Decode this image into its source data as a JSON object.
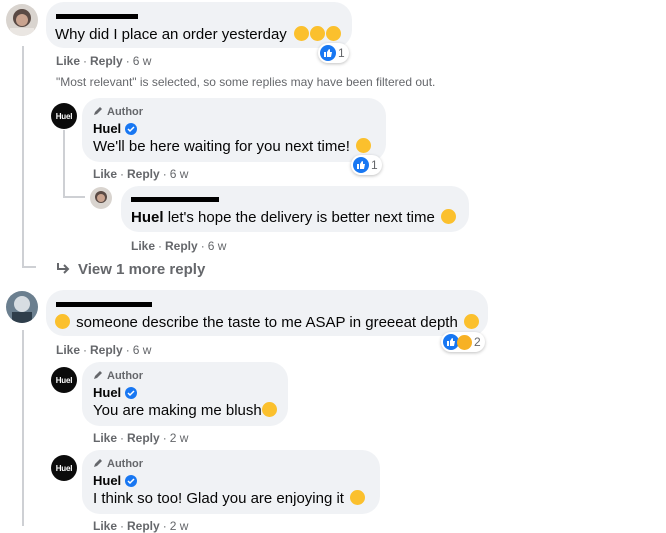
{
  "comments": [
    {
      "id": "c1",
      "text": "Why did I place an order yesterday",
      "reaction_count": "1",
      "actions": {
        "like": "Like",
        "reply": "Reply",
        "time": "6 w"
      }
    },
    {
      "id": "r1",
      "author_badge": "Author",
      "name": "Huel",
      "avatar_text": "Huel",
      "text": "We'll be here waiting for you next time!",
      "reaction_count": "1",
      "actions": {
        "like": "Like",
        "reply": "Reply",
        "time": "6 w"
      }
    },
    {
      "id": "r2",
      "mention": "Huel",
      "text": "let's hope the delivery is better next time",
      "actions": {
        "like": "Like",
        "reply": "Reply",
        "time": "6 w"
      }
    },
    {
      "id": "c2",
      "text": "someone describe the taste to me ASAP in greeeat depth",
      "reaction_count": "2",
      "actions": {
        "like": "Like",
        "reply": "Reply",
        "time": "6 w"
      }
    },
    {
      "id": "r3",
      "author_badge": "Author",
      "name": "Huel",
      "avatar_text": "Huel",
      "text": "You are making me blush",
      "actions": {
        "like": "Like",
        "reply": "Reply",
        "time": "2 w"
      }
    },
    {
      "id": "r4",
      "author_badge": "Author",
      "name": "Huel",
      "avatar_text": "Huel",
      "text": "I think so too! Glad you are enjoying it",
      "actions": {
        "like": "Like",
        "reply": "Reply",
        "time": "2 w"
      }
    }
  ],
  "filter_note": "\"Most relevant\" is selected, so some replies may have been filtered out.",
  "view_more": "View 1 more reply",
  "colors": {
    "bubble": "#f0f2f5",
    "meta": "#65676b",
    "blue": "#1877f2"
  }
}
